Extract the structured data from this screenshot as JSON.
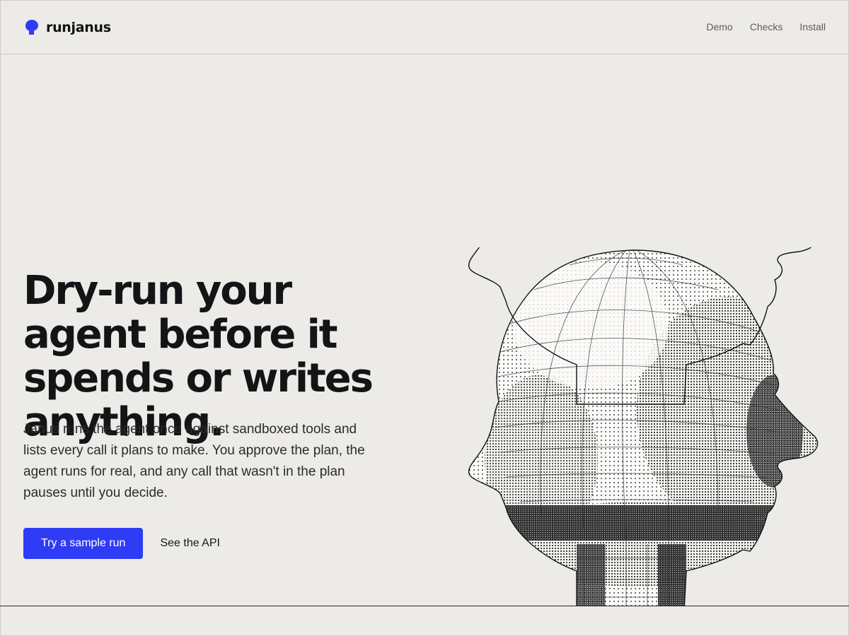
{
  "header": {
    "brand_name": "runjanus",
    "logo_icon": "head-icon",
    "nav": [
      "Demo",
      "Checks",
      "Install"
    ]
  },
  "hero": {
    "title": "Dry-run your agent before it spends or writes anything.",
    "description": "Janus runs the agent once against sandboxed tools and lists every call it plans to make. You approve the plan, the agent runs for real, and any call that wasn't in the plan pauses until you decide.",
    "primary_cta": "Try a sample run",
    "secondary_cta": "See the API"
  },
  "colors": {
    "background": "#edebe7",
    "accent": "#2f3cf5",
    "text": "#17161a"
  }
}
